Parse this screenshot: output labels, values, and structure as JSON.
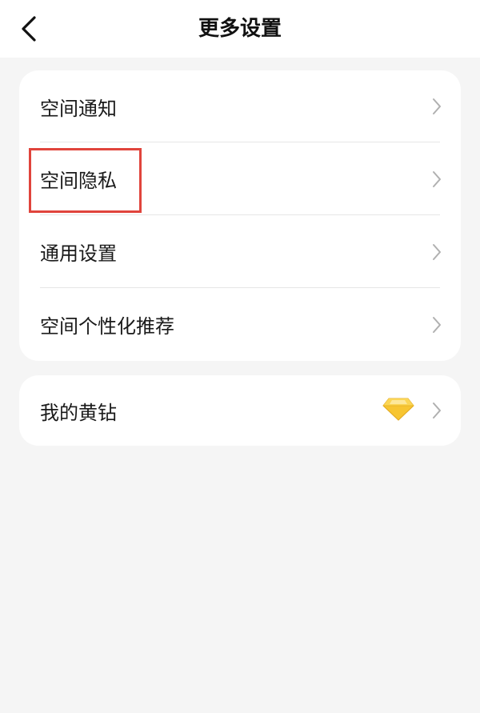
{
  "header": {
    "title": "更多设置",
    "back_icon": "chevron-left-icon"
  },
  "settings_group": {
    "items": [
      {
        "label": "空间通知",
        "icon": "chevron-right-icon"
      },
      {
        "label": "空间隐私",
        "icon": "chevron-right-icon",
        "highlighted": true
      },
      {
        "label": "通用设置",
        "icon": "chevron-right-icon"
      },
      {
        "label": "空间个性化推荐",
        "icon": "chevron-right-icon"
      }
    ]
  },
  "vip_group": {
    "label": "我的黄钻",
    "badge_icon": "yellow-diamond-icon",
    "icon": "chevron-right-icon"
  },
  "colors": {
    "background": "#f5f5f5",
    "card": "#ffffff",
    "highlight": "#e0443c",
    "diamond": "#f7c531"
  }
}
